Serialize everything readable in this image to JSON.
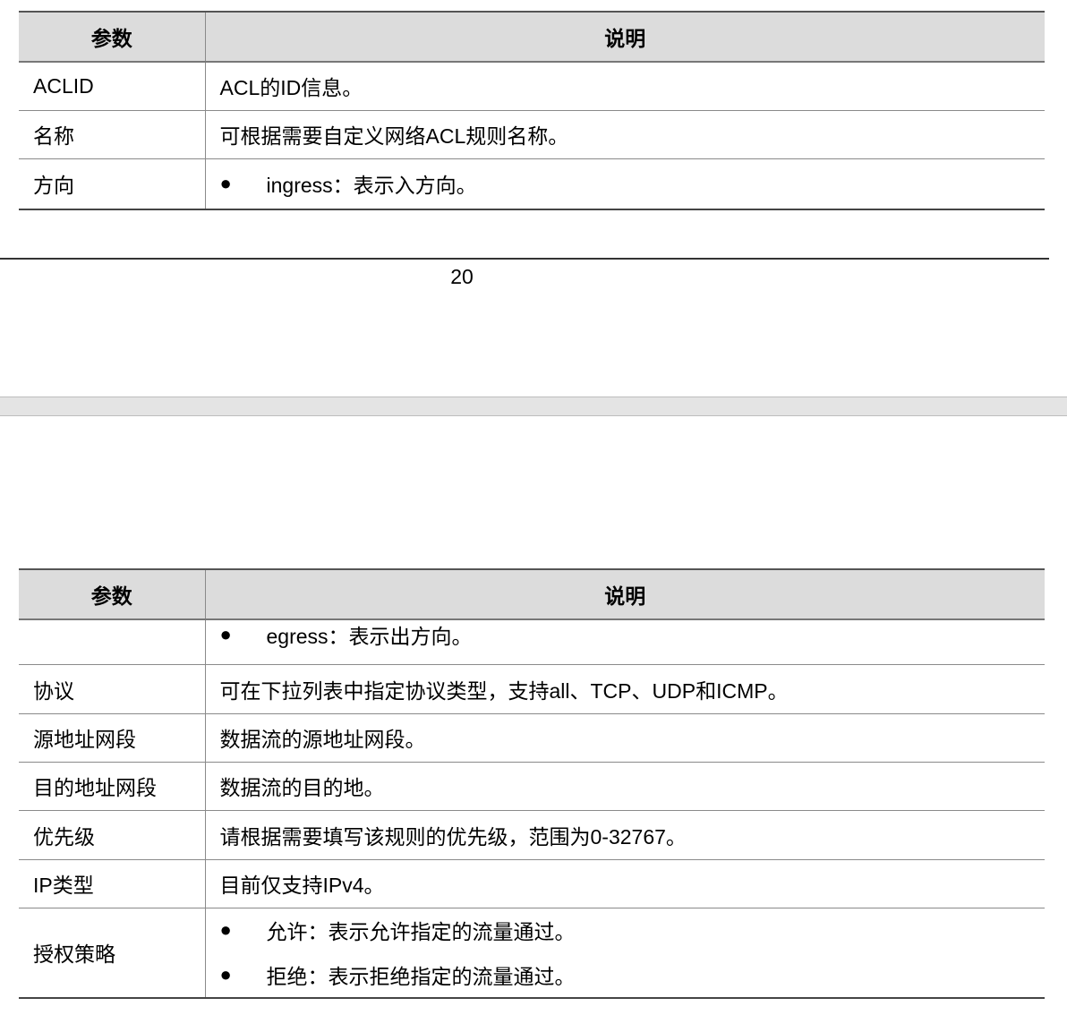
{
  "table1": {
    "headers": [
      "参数",
      "说明"
    ],
    "rows": [
      {
        "param": "ACLID",
        "desc": "ACL的ID信息。"
      },
      {
        "param": "名称",
        "desc": "可根据需要自定义网络ACL规则名称。"
      },
      {
        "param": "方向",
        "bullet": "ingress：表示入方向。"
      }
    ]
  },
  "footer": {
    "page_number": "20"
  },
  "table2": {
    "headers": [
      "参数",
      "说明"
    ],
    "rows": [
      {
        "param": "",
        "bullet": "egress：表示出方向。"
      },
      {
        "param": "协议",
        "desc": "可在下拉列表中指定协议类型，支持all、TCP、UDP和ICMP。"
      },
      {
        "param": "源地址网段",
        "desc": "数据流的源地址网段。"
      },
      {
        "param": "目的地址网段",
        "desc": "数据流的目的地。"
      },
      {
        "param": "优先级",
        "desc": "请根据需要填写该规则的优先级，范围为0-32767。"
      },
      {
        "param": "IP类型",
        "desc": "目前仅支持IPv4。"
      },
      {
        "param": "授权策略",
        "bullets": [
          "允许：表示允许指定的流量通过。",
          "拒绝：表示拒绝指定的流量通过。"
        ]
      }
    ]
  },
  "bullet_glyph": "●"
}
